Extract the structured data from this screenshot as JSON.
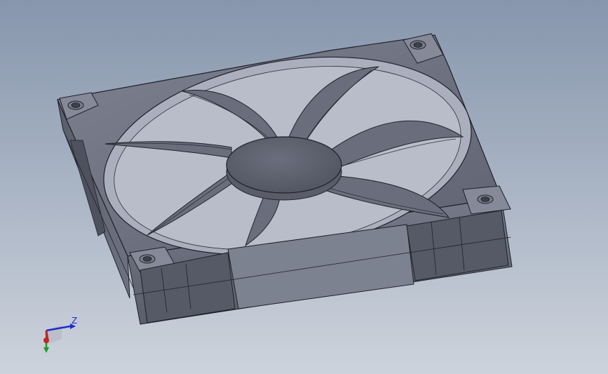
{
  "viewport": {
    "background_top": "#8796ad",
    "background_bottom": "#cdd3dc"
  },
  "model": {
    "part": "fan-assembly",
    "body_color": "#6d717f",
    "edge_color": "#1e2028",
    "blade_count": 7
  },
  "triad": {
    "z_label": "Z",
    "z_color": "#1c2ec8",
    "y_color": "#1f9a2a",
    "x_color": "#c52222"
  }
}
